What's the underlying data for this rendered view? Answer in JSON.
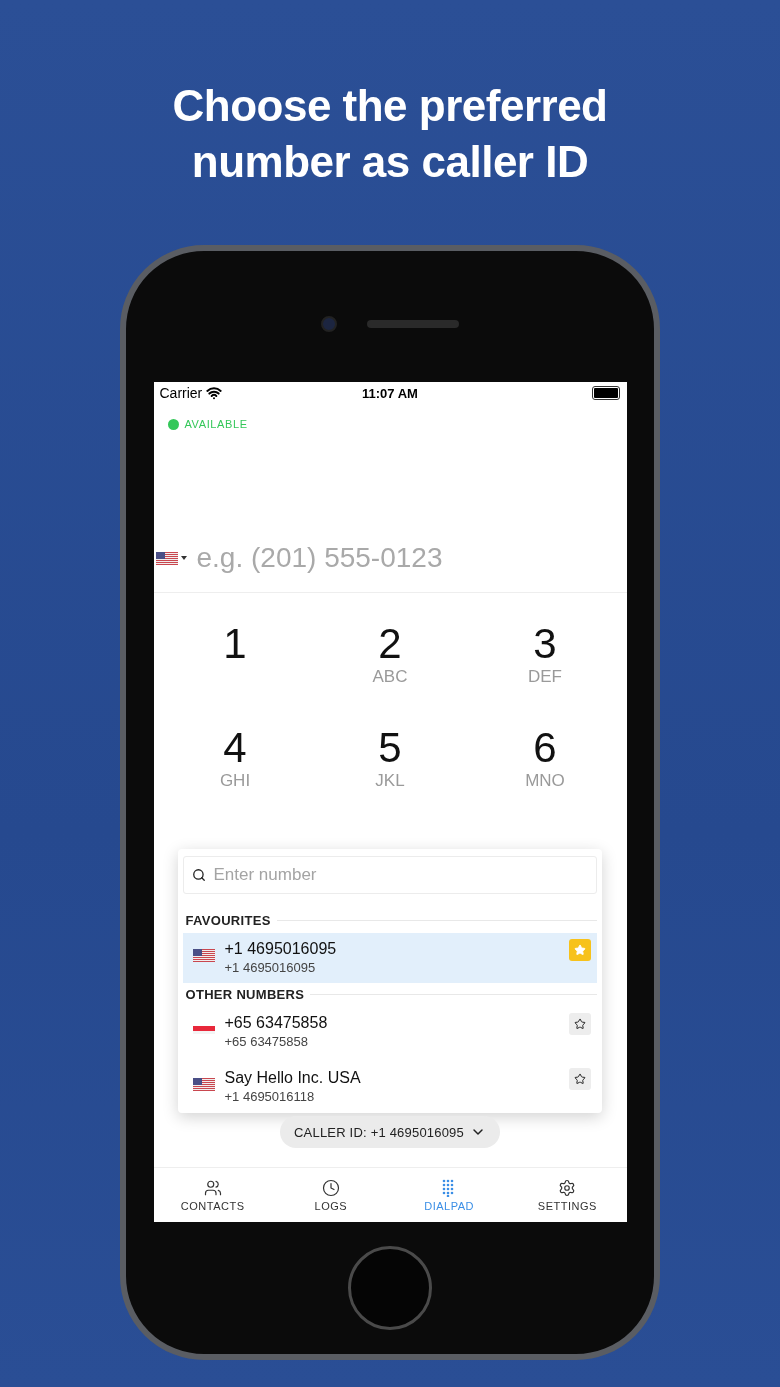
{
  "headline": "Choose the preferred number as caller ID",
  "status_bar": {
    "carrier": "Carrier",
    "time": "11:07 AM"
  },
  "presence": {
    "label": "AVAILABLE",
    "color": "#34c759"
  },
  "number_field": {
    "flag": {
      "kind": "us"
    },
    "placeholder": "e.g. (201) 555-0123"
  },
  "keypad": [
    {
      "digit": "1"
    },
    {
      "digit": "2",
      "letters": "ABC"
    },
    {
      "digit": "3",
      "letters": "DEF"
    },
    {
      "digit": "4",
      "letters": "GHI"
    },
    {
      "digit": "5",
      "letters": "JKL"
    },
    {
      "digit": "6",
      "letters": "MNO"
    }
  ],
  "picker": {
    "search": {
      "placeholder": "Enter number"
    },
    "sections": [
      {
        "title": "FAVOURITES",
        "items": [
          {
            "name": "+1 4695016095",
            "number": "+1 4695016095",
            "flag": {
              "kind": "us"
            },
            "favourite": true,
            "selected": true
          }
        ]
      },
      {
        "title": "OTHER NUMBERS",
        "items": [
          {
            "name": "+65 63475858",
            "number": "+65 63475858",
            "flag": {
              "kind": "sg"
            },
            "favourite": false,
            "selected": false
          },
          {
            "name": "Say Hello Inc. USA",
            "number": "+1 4695016118",
            "flag": {
              "kind": "us"
            },
            "favourite": false,
            "selected": false
          }
        ]
      }
    ]
  },
  "caller_id": "CALLER ID: +1 4695016095",
  "tabs": [
    {
      "label": "CONTACTS",
      "kind": "contacts",
      "selected": false
    },
    {
      "label": "LOGS",
      "kind": "logs",
      "selected": false
    },
    {
      "label": "DIALPAD",
      "kind": "dialpad",
      "selected": true
    },
    {
      "label": "SETTINGS",
      "kind": "settings",
      "selected": false
    }
  ]
}
